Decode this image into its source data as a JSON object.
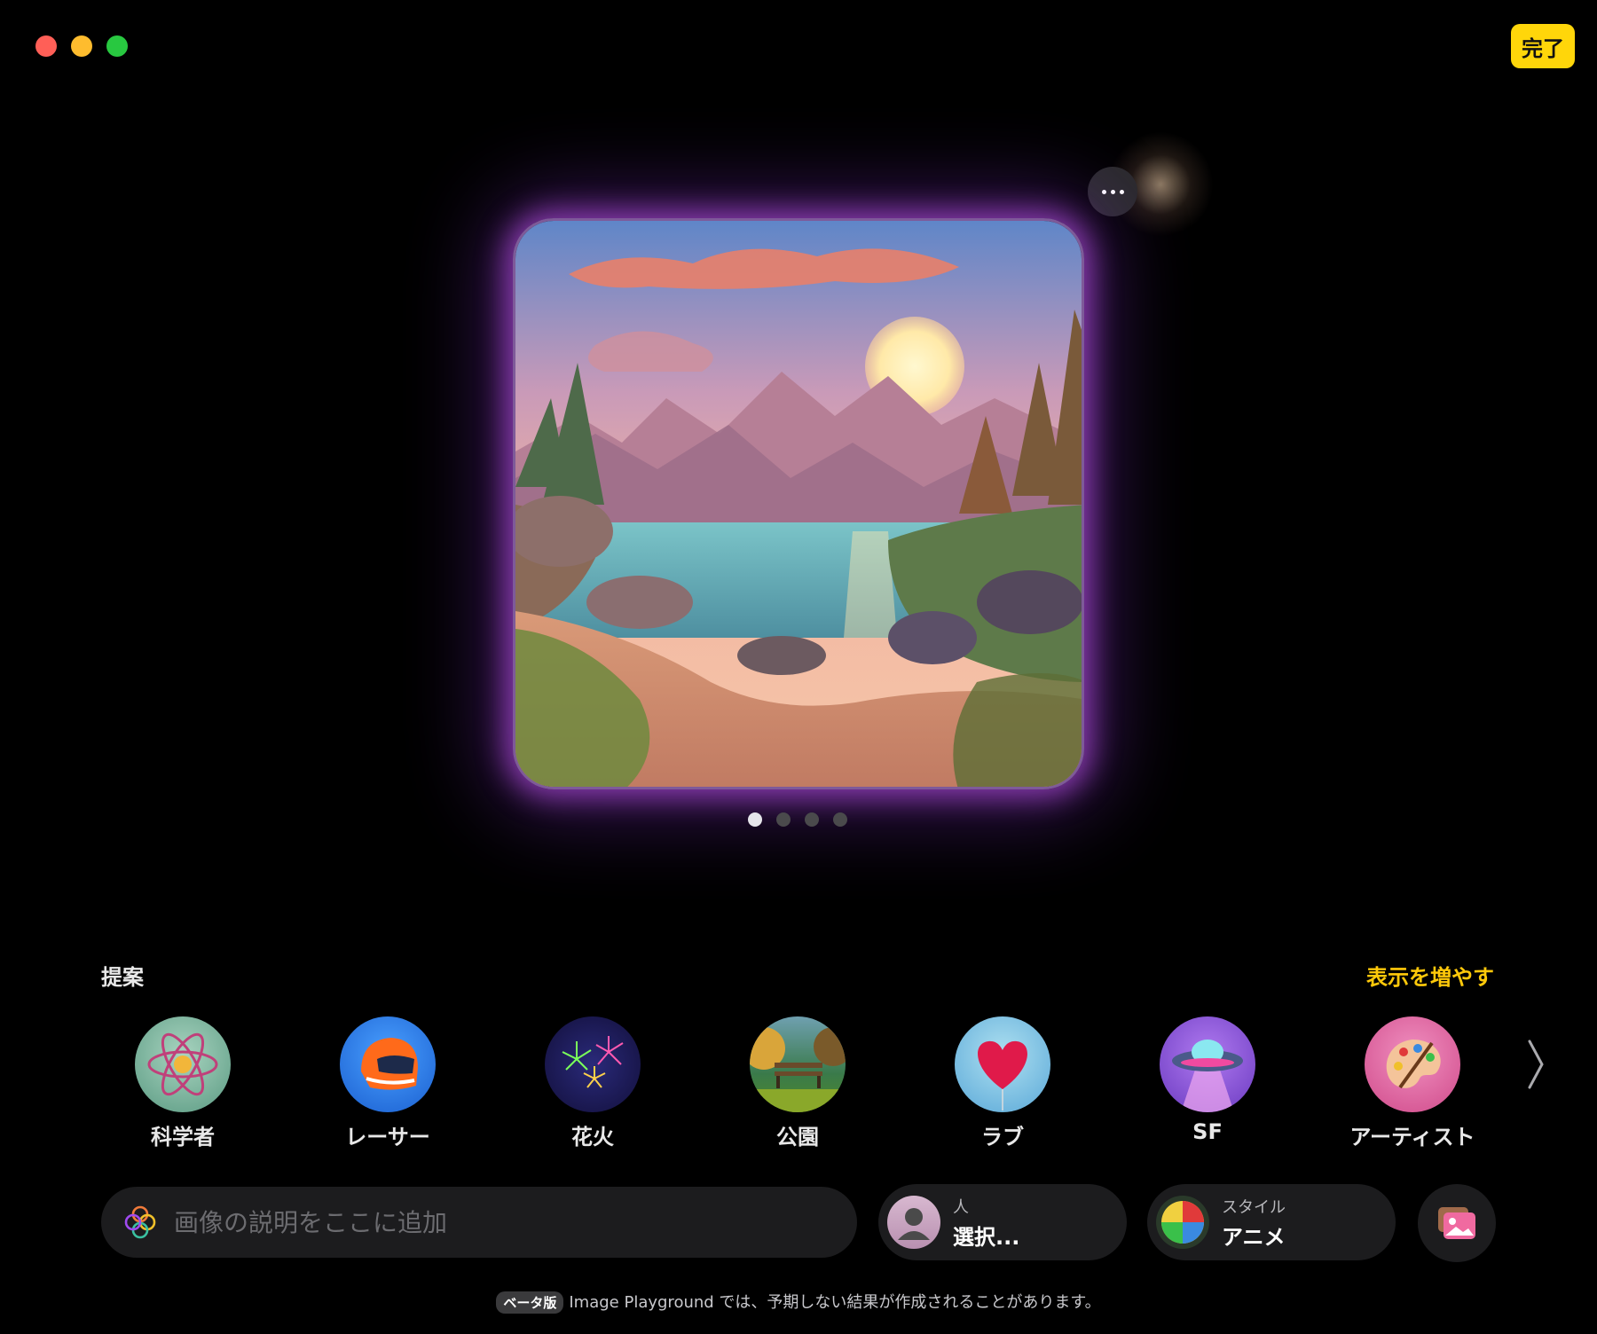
{
  "window": {
    "done_label": "完了"
  },
  "image": {
    "more_label": "...",
    "pages": 4,
    "active_page": 1
  },
  "suggestions": {
    "title": "提案",
    "more_link": "表示を増やす",
    "items": [
      {
        "label": "科学者",
        "icon": "atom-icon"
      },
      {
        "label": "レーサー",
        "icon": "racing-helmet-icon"
      },
      {
        "label": "花火",
        "icon": "fireworks-icon"
      },
      {
        "label": "公園",
        "icon": "park-bench-icon"
      },
      {
        "label": "ラブ",
        "icon": "heart-icon"
      },
      {
        "label": "SF",
        "icon": "ufo-icon"
      },
      {
        "label": "アーティスト",
        "icon": "palette-icon"
      }
    ]
  },
  "prompt": {
    "placeholder": "画像の説明をここに追加"
  },
  "people": {
    "sub": "人",
    "main": "選択..."
  },
  "style": {
    "sub": "スタイル",
    "main": "アニメ"
  },
  "footer": {
    "badge": "ベータ版",
    "text": "Image Playground では、予期しない結果が作成されることがあります。"
  },
  "colors": {
    "accent": "#ffd60a",
    "link": "#ffc90a",
    "glow": "#cd5aff"
  }
}
